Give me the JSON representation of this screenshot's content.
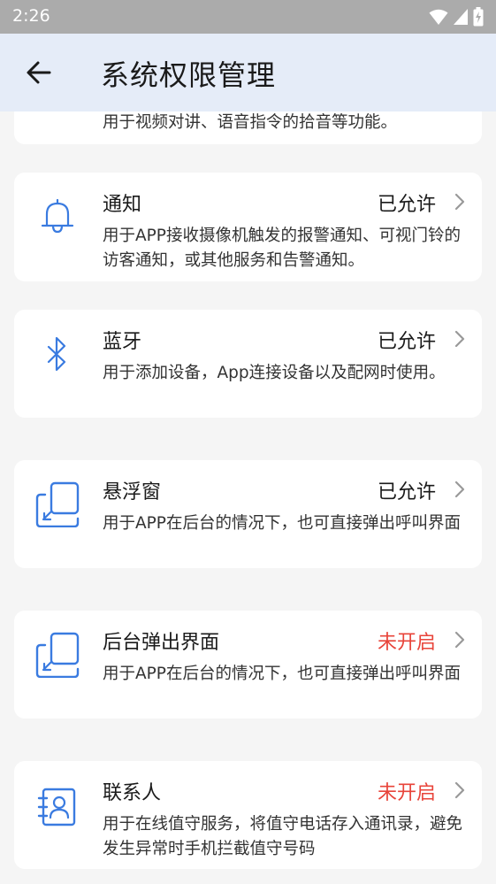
{
  "status_bar": {
    "time": "2:26"
  },
  "header": {
    "title": "系统权限管理"
  },
  "partial_card": {
    "description": "用于视频对讲、语音指令的拾音等功能。"
  },
  "permissions": [
    {
      "title": "通知",
      "status": "已允许",
      "icon": "bell-icon",
      "description": "用于APP接收摄像机触发的报警通知、可视门铃的访客通知，或其他服务和告警通知。"
    },
    {
      "title": "蓝牙",
      "status": "已允许",
      "icon": "bluetooth-icon",
      "description": "用于添加设备，App连接设备以及配网时使用。"
    },
    {
      "title": "悬浮窗",
      "status": "已允许",
      "icon": "floating-window-icon",
      "description": "用于APP在后台的情况下，也可直接弹出呼叫界面"
    },
    {
      "title": "后台弹出界面",
      "status": "未开启",
      "icon": "background-popup-icon",
      "description": "用于APP在后台的情况下，也可直接弹出呼叫界面"
    },
    {
      "title": "联系人",
      "status": "未开启",
      "icon": "contacts-icon",
      "description": "用于在线值守服务，将值守电话存入通讯录，避免发生异常时手机拦截值守号码"
    }
  ],
  "colors": {
    "accent": "#3a7be0",
    "denied": "#e8443a",
    "header_bg": "#e5ecf8"
  }
}
